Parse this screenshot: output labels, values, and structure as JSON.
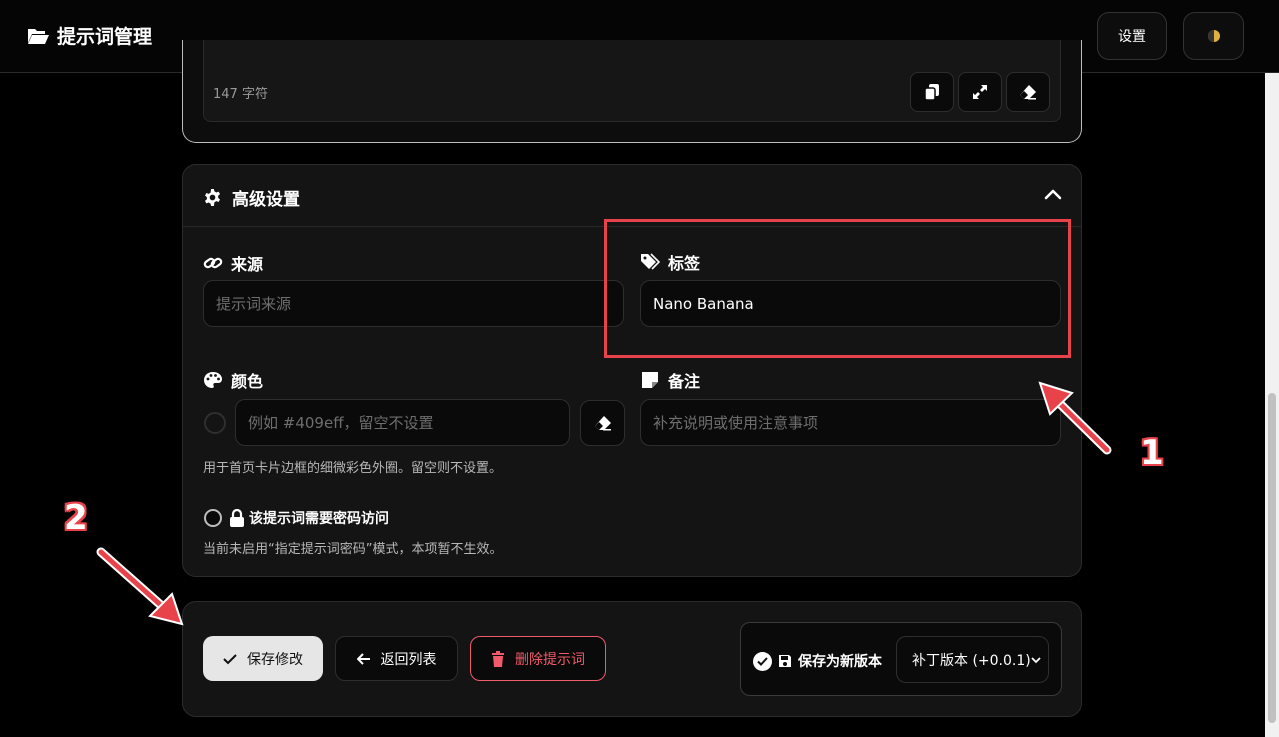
{
  "app": {
    "title": "提示词管理",
    "settings_label": "设置"
  },
  "editor": {
    "char_count": "147 字符"
  },
  "advanced": {
    "title": "高级设置",
    "source": {
      "label": "来源",
      "placeholder": "提示词来源",
      "value": ""
    },
    "tags": {
      "label": "标签",
      "value": "Nano Banana"
    },
    "color": {
      "label": "颜色",
      "placeholder": "例如 #409eff，留空不设置",
      "hint": "用于首页卡片边框的细微彩色外圈。留空则不设置。"
    },
    "notes": {
      "label": "备注",
      "placeholder": "补充说明或使用注意事项"
    },
    "password": {
      "label": "该提示词需要密码访问",
      "hint": "当前未启用“指定提示词密码”模式，本项暂不生效。"
    }
  },
  "actions": {
    "save_label": "保存修改",
    "back_label": "返回列表",
    "delete_label": "删除提示词",
    "save_new_version_label": "保存为新版本",
    "version_option": "补丁版本 (+0.0.1)"
  },
  "annotations": {
    "marker_1": "1",
    "marker_2": "2",
    "color": "#e8424a"
  },
  "colors": {
    "accent_delete": "#f05a6a",
    "background": "#000000",
    "panel": "#141414"
  }
}
